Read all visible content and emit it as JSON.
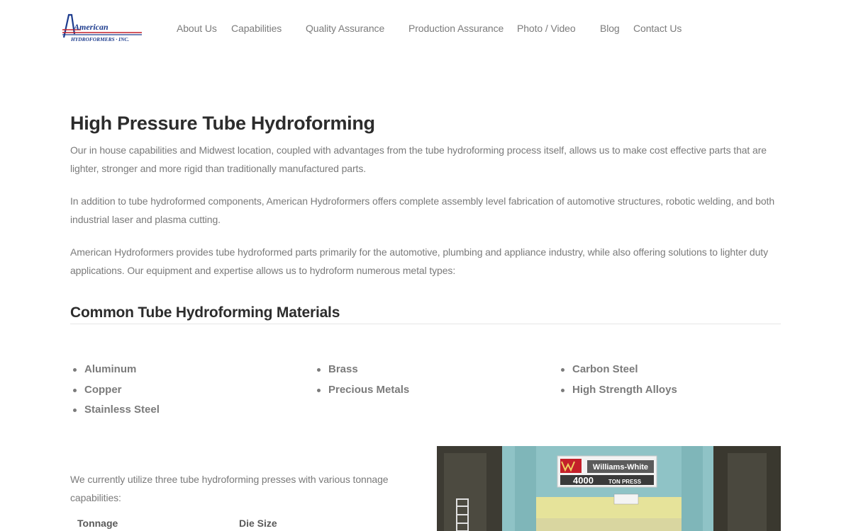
{
  "header": {
    "logo": {
      "line1": "American",
      "line2": "HYDROFORMERS · INC."
    },
    "nav": [
      {
        "label": "About Us"
      },
      {
        "label": "Capabilities"
      },
      {
        "label": "Quality Assurance"
      },
      {
        "label": "Production Assurance"
      },
      {
        "label": "Photo / Video"
      },
      {
        "label": "Blog"
      },
      {
        "label": "Contact Us"
      }
    ]
  },
  "main": {
    "title": "High Pressure Tube Hydroforming",
    "paragraphs": [
      "Our in house capabilities and Midwest location, coupled with advantages from the tube hydroforming process itself, allows us to make cost effective parts that are lighter, stronger and more rigid than traditionally manufactured parts.",
      "In addition to tube hydroformed components, American Hydroformers offers complete assembly level fabrication of automotive structures, robotic welding, and both industrial laser and plasma cutting.",
      "American Hydroformers provides tube hydroformed parts primarily for the automotive, plumbing and appliance industry, while also offering solutions to lighter duty applications.  Our equipment and expertise allows us to hydroform numerous metal types:"
    ],
    "materials_heading": "Common Tube Hydroforming Materials",
    "materials": {
      "col1": [
        "Aluminum",
        "Copper",
        "Stainless Steel"
      ],
      "col2": [
        "Brass",
        "Precious Metals"
      ],
      "col3": [
        "Carbon Steel",
        "High Strength Alloys"
      ]
    },
    "presses_text": "We currently utilize three tube hydroforming presses with various tonnage capabilities:",
    "table_headers": [
      "Tonnage",
      "Die Size"
    ],
    "photo": {
      "sign_brand": "Williams-White",
      "sign_capacity": "4000",
      "sign_unit": "TON PRESS",
      "colors": {
        "frame": "#8fc3c6",
        "band": "#e6e39a",
        "sign": "#f3f3f3"
      }
    }
  },
  "colors": {
    "heading": "#2c2c2c",
    "body_text": "#7a7a7a",
    "logo_blue": "#1d3c8e",
    "logo_red": "#c4202a"
  }
}
